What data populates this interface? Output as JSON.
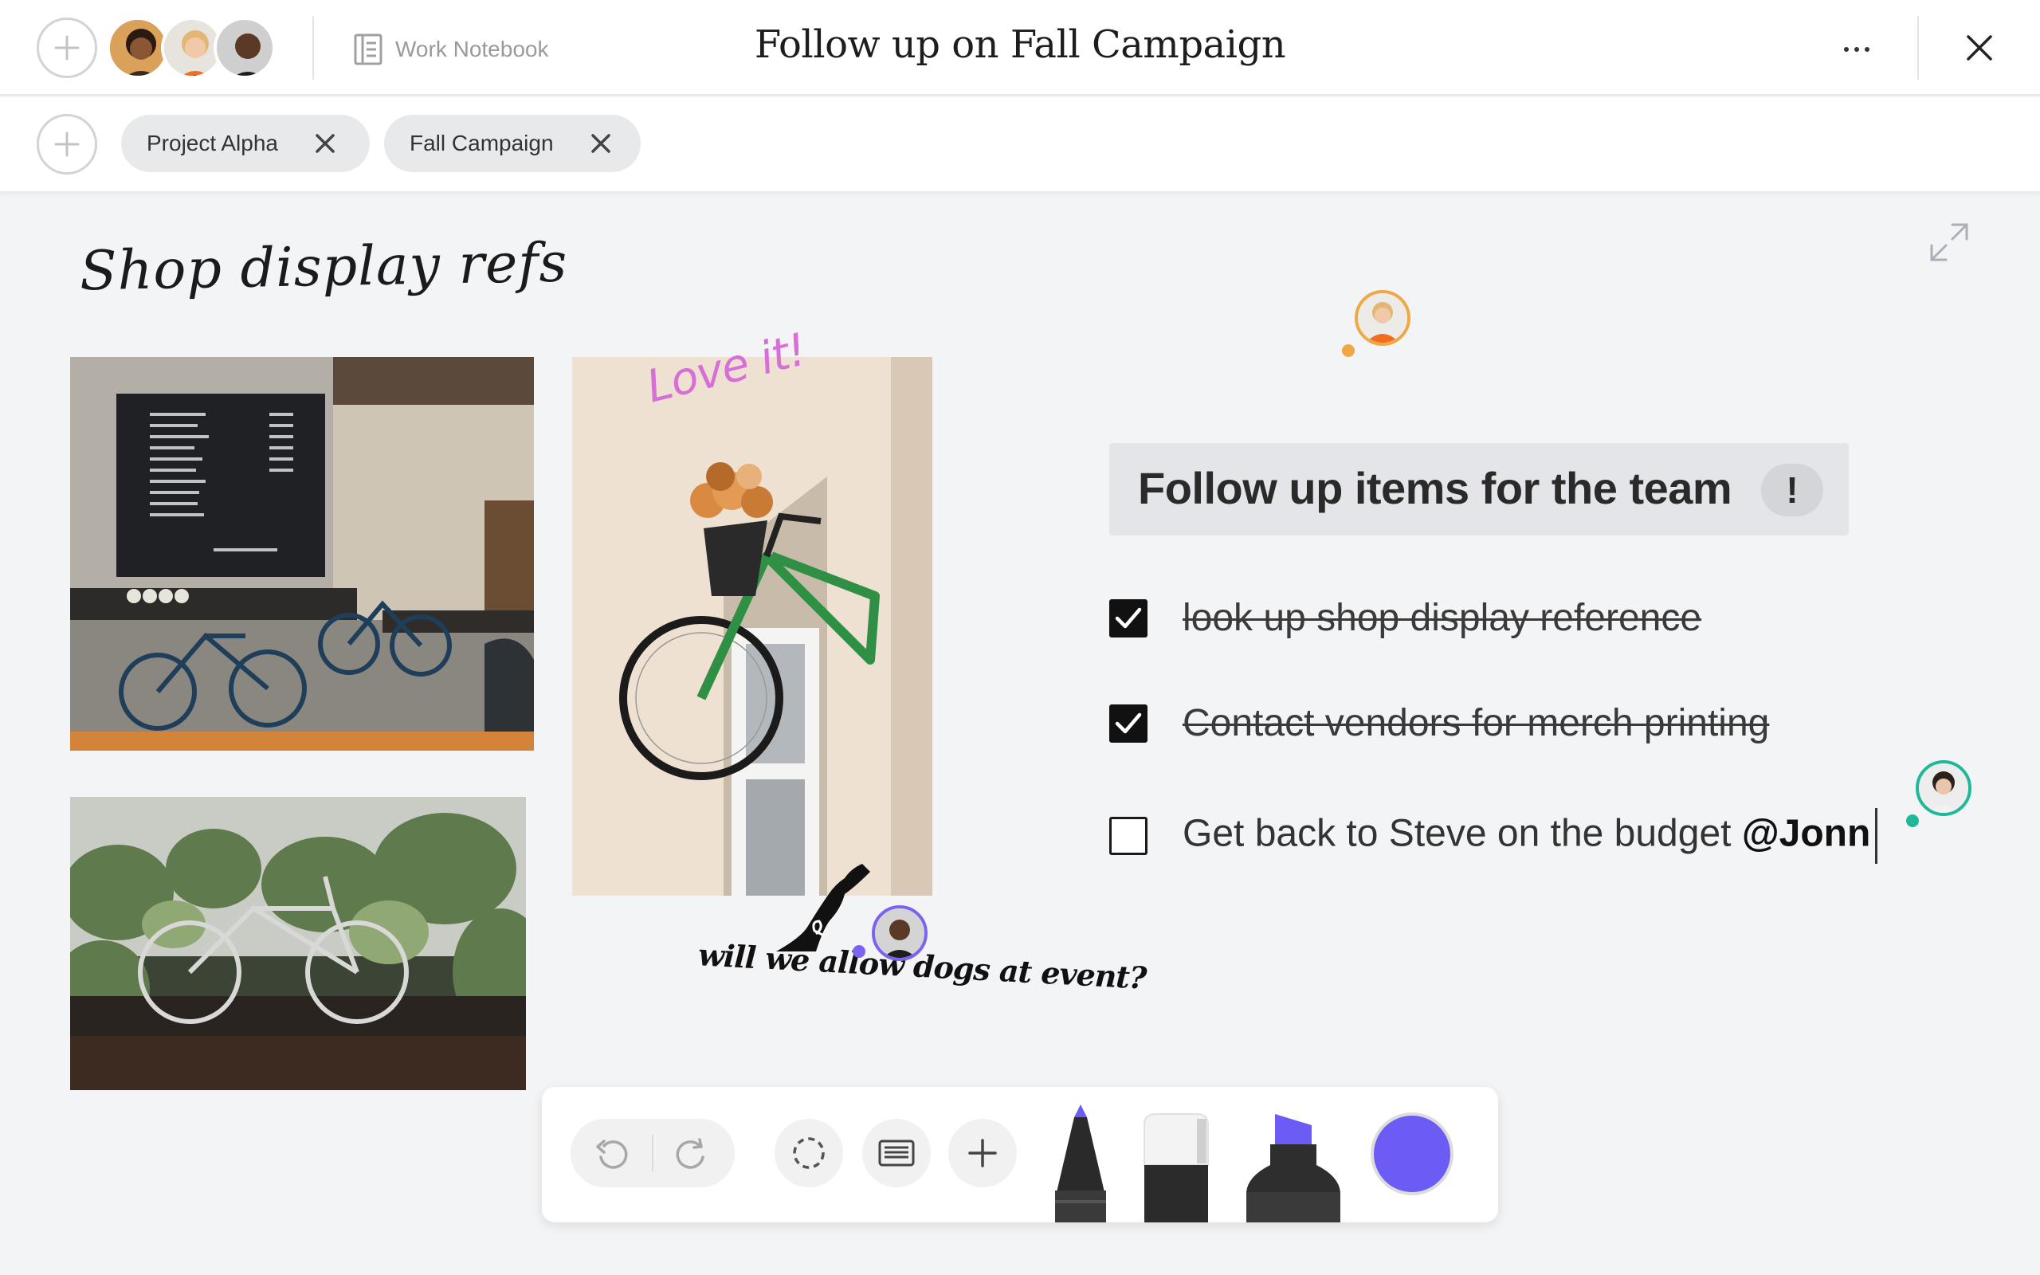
{
  "header": {
    "add_label": "+",
    "notebook_label": "Work Notebook",
    "title": "Follow up on Fall Campaign"
  },
  "tags": [
    {
      "label": "Project Alpha"
    },
    {
      "label": "Fall Campaign"
    }
  ],
  "canvas": {
    "heading": "Shop display refs",
    "love_note": "Love it!",
    "dogs_note": "will we allow dogs at event?"
  },
  "followup": {
    "title": "Follow up items for the team",
    "priority_mark": "!",
    "items": [
      {
        "text": "look up shop display reference",
        "checked": true
      },
      {
        "text": "Contact vendors for merch printing",
        "checked": true
      },
      {
        "text": "Get back to Steve on the budget ",
        "mention": "@Jonn",
        "checked": false
      }
    ]
  },
  "toolbar": {
    "active_color": "#6b5cf5"
  },
  "colors": {
    "collab_orange": "#f0a846",
    "collab_teal": "#1fb89a",
    "collab_purple": "#7d62f0",
    "love_pink": "#d66fd6",
    "ink_purple": "#6b5cf5"
  },
  "icons": [
    "plus-icon",
    "notebook-icon",
    "more-icon",
    "close-icon",
    "tag-close-icon",
    "expand-icon",
    "undo-icon",
    "redo-icon",
    "lasso-icon",
    "keyboard-icon",
    "pen-tool-icon",
    "eraser-tool-icon",
    "highlighter-tool-icon"
  ]
}
